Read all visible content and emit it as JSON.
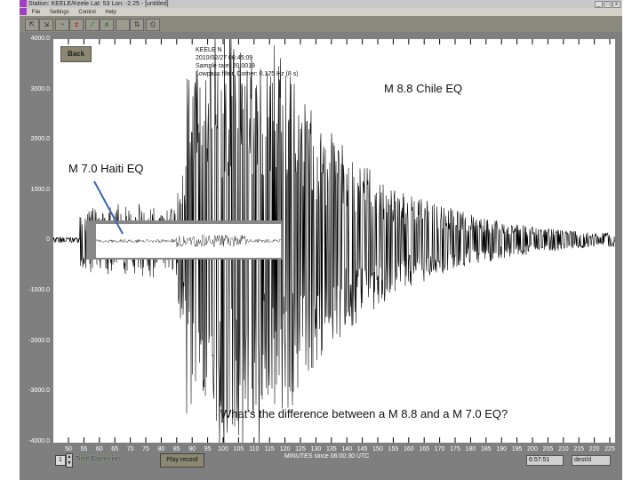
{
  "window": {
    "title": "Station: KEELE/Keele Lat: 53 Lon: -2.25 - [untitled]",
    "menu": [
      "File",
      "Settings",
      "Control",
      "Help"
    ]
  },
  "toolbar": {
    "buttons": [
      "open-icon",
      "save-icon",
      "filter-icon",
      "amplitude-icon",
      "zoom-line-icon",
      "peak-icon",
      "disabled-icon",
      "arrows-icon",
      "print-icon"
    ]
  },
  "plot": {
    "back_label": "Back",
    "info": [
      "KEELE  N",
      "2010/02/27 06:45:09",
      "Sample rate: 20.0019",
      "Lowpass filter, Corner: 0.125 Hz (8 s)"
    ],
    "y_ticks": [
      "4000.0",
      "3000.0",
      "2000.0",
      "1000.0",
      "0",
      "-1000.0",
      "-2000.0",
      "-3000.0",
      "-4000.0"
    ],
    "x_ticks": [
      "50",
      "55",
      "60",
      "65",
      "70",
      "75",
      "80",
      "85",
      "90",
      "95",
      "100",
      "105",
      "110",
      "115",
      "120",
      "125",
      "130",
      "135",
      "140",
      "145",
      "150",
      "155",
      "160",
      "165",
      "170",
      "175",
      "180",
      "185",
      "190",
      "195",
      "200",
      "205",
      "210",
      "215",
      "220",
      "225"
    ],
    "x_axis_label": "MINUTES since 06:00:30 UTC",
    "trace_color": "#000000"
  },
  "annotations": {
    "chile": "M 8.8 Chile EQ",
    "haiti": "M 7.0 Haiti EQ",
    "question": "What’s the difference between a M 8.8 and a M 7.0 EQ?",
    "arrow_color": "#3a63b0"
  },
  "bottom": {
    "spinner_value": "1",
    "time_expansion": "Time Expansion",
    "play_record": "Play record",
    "clock": "6:57:51",
    "field2": "dest/d"
  }
}
